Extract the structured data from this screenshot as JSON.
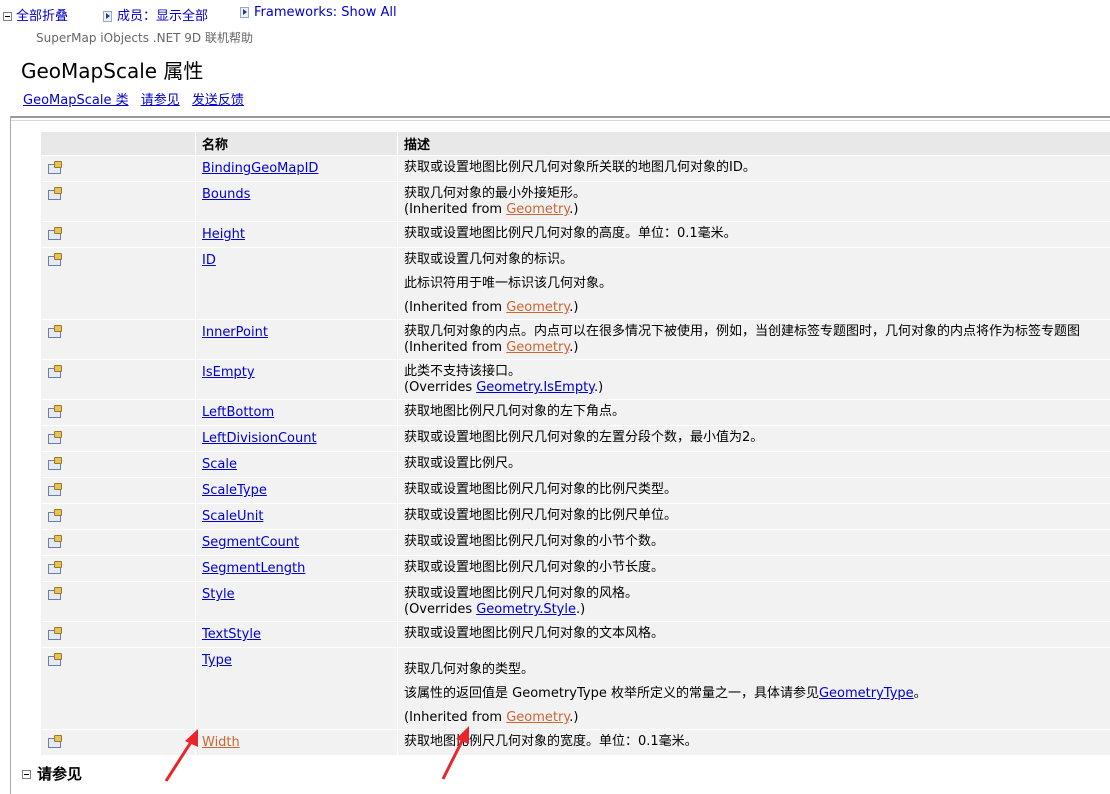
{
  "toolbar": {
    "collapse_all": "全部折叠",
    "members": "成员：显示全部",
    "frameworks": "Frameworks: Show All"
  },
  "header": {
    "product": "SuperMap iObjects .NET 9D 联机帮助",
    "title": "GeoMapScale 属性",
    "links": [
      "GeoMapScale 类",
      "请参见",
      "发送反馈"
    ]
  },
  "table": {
    "col_name": "名称",
    "col_desc": "描述",
    "rows": [
      {
        "name": "BindingGeoMapID",
        "desc": [
          "获取或设置地图比例尺几何对象所关联的地图几何对象的ID。"
        ]
      },
      {
        "name": "Bounds",
        "desc": [
          "获取几何对象的最小外接矩形。"
        ],
        "note_prefix": "(Inherited from ",
        "note_link": "Geometry",
        "note_suffix": ".)"
      },
      {
        "name": "Height",
        "desc": [
          "获取或设置地图比例尺几何对象的高度。单位：0.1毫米。"
        ]
      },
      {
        "name": "ID",
        "desc": [
          "获取或设置几何对象的标识。",
          "此标识符用于唯一标识该几何对象。"
        ],
        "note_prefix": "(Inherited from ",
        "note_link": "Geometry",
        "note_suffix": ".)"
      },
      {
        "name": "InnerPoint",
        "desc": [
          "获取几何对象的内点。内点可以在很多情况下被使用，例如，当创建标签专题图时，几何对象的内点将作为标签专题图"
        ],
        "note_prefix": "(Inherited from ",
        "note_link": "Geometry",
        "note_suffix": ".)"
      },
      {
        "name": "IsEmpty",
        "desc": [
          "此类不支持该接口。"
        ],
        "note_prefix": "(Overrides ",
        "note_link": "Geometry.IsEmpty",
        "note_suffix": ".)"
      },
      {
        "name": "LeftBottom",
        "desc": [
          "获取地图比例尺几何对象的左下角点。"
        ]
      },
      {
        "name": "LeftDivisionCount",
        "desc": [
          "获取或设置地图比例尺几何对象的左置分段个数，最小值为2。"
        ]
      },
      {
        "name": "Scale",
        "desc": [
          "获取或设置比例尺。"
        ]
      },
      {
        "name": "ScaleType",
        "desc": [
          "获取或设置地图比例尺几何对象的比例尺类型。"
        ]
      },
      {
        "name": "ScaleUnit",
        "desc": [
          "获取或设置地图比例尺几何对象的比例尺单位。"
        ]
      },
      {
        "name": "SegmentCount",
        "desc": [
          "获取或设置地图比例尺几何对象的小节个数。"
        ]
      },
      {
        "name": "SegmentLength",
        "desc": [
          "获取或设置地图比例尺几何对象的小节长度。"
        ]
      },
      {
        "name": "Style",
        "desc": [
          "获取或设置地图比例尺几何对象的风格。"
        ],
        "note_prefix": "(Overrides ",
        "note_link": "Geometry.Style",
        "note_suffix": ".)"
      },
      {
        "name": "TextStyle",
        "desc": [
          "获取或设置地图比例尺几何对象的文本风格。"
        ]
      },
      {
        "name": "Type",
        "desc": [
          "获取几何对象的类型。"
        ],
        "desc2_prefix": "该属性的返回值是 GeometryType 枚举所定义的常量之一，具体请参见",
        "desc2_link": "GeometryType",
        "desc2_suffix": "。",
        "note_prefix": "(Inherited from ",
        "note_link": "Geometry",
        "note_suffix": ".)"
      },
      {
        "name": "Width",
        "desc": [
          "获取地图比例尺几何对象的宽度。单位：0.1毫米。"
        ]
      }
    ]
  },
  "see_also": "请参见",
  "colors": {
    "link": "#0000cc",
    "visited": "#cc6633",
    "arrow": "#e8262b"
  }
}
